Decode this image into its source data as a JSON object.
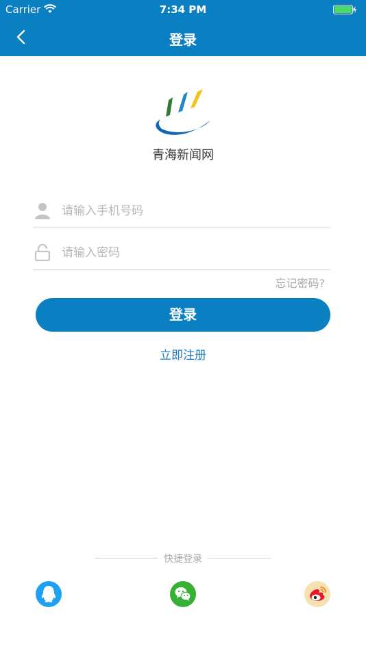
{
  "status_bar": {
    "carrier": "Carrier",
    "time": "7:34 PM"
  },
  "nav": {
    "title": "登录"
  },
  "brand": {
    "site_name": "青海新闻网"
  },
  "form": {
    "phone_placeholder": "请输入手机号码",
    "password_placeholder": "请输入密码",
    "forgot_label": "忘记密码?",
    "login_label": "登录",
    "register_label": "立即注册"
  },
  "quick_login": {
    "label": "快捷登录",
    "providers": [
      "qq-icon",
      "wechat-icon",
      "weibo-icon"
    ]
  },
  "colors": {
    "primary": "#0a7fc1",
    "qq": "#1ea1f2",
    "wechat": "#38b035",
    "weibo_bg": "#f5e2b0"
  }
}
